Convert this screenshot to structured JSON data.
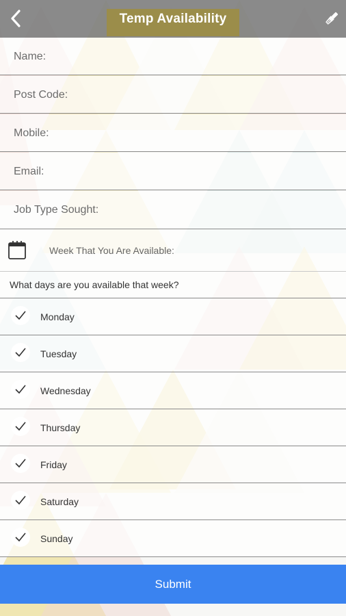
{
  "header": {
    "title": "Temp Availability",
    "back_icon": "chevron-left-icon",
    "action_icon": "paintbrush-icon"
  },
  "form": {
    "fields": [
      {
        "label": "Name:"
      },
      {
        "label": "Post Code:"
      },
      {
        "label": "Mobile:"
      },
      {
        "label": "Email:"
      },
      {
        "label": "Job Type Sought:"
      }
    ],
    "week_label": "Week That You Are Available:",
    "week_icon": "calendar-icon",
    "days_question": "What days are you available that week?",
    "days": [
      {
        "label": "Monday",
        "checked": true
      },
      {
        "label": "Tuesday",
        "checked": true
      },
      {
        "label": "Wednesday",
        "checked": true
      },
      {
        "label": "Thursday",
        "checked": true
      },
      {
        "label": "Friday",
        "checked": true
      },
      {
        "label": "Saturday",
        "checked": true
      },
      {
        "label": "Sunday",
        "checked": true
      }
    ],
    "submit_label": "Submit"
  },
  "colors": {
    "header_bg": "#808080",
    "title_accent": "#9b8d4a",
    "submit_bg": "#3a83f0",
    "pattern_yellow": "#efe3a6",
    "pattern_pink": "#f0d7d2",
    "pattern_teal": "#d6e6e4"
  }
}
